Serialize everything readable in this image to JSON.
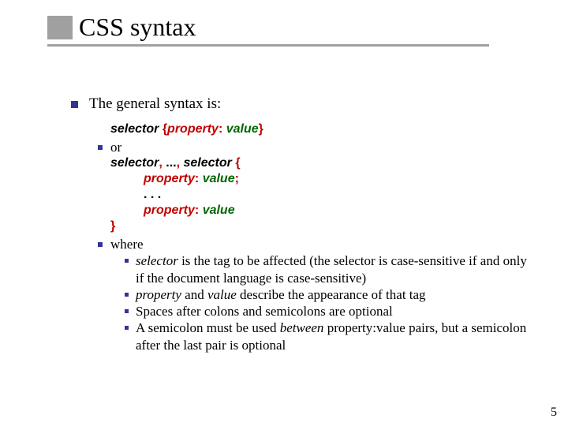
{
  "title": "CSS syntax",
  "lead": "The general syntax is:",
  "code1": {
    "sel": "selector",
    "lb": " {",
    "prop": "property",
    "colon": ": ",
    "val": "value",
    "rb": "}"
  },
  "or": "or",
  "code2": {
    "line1_a": "selector",
    "line1_b": ", ",
    "line1_c": "...",
    "line1_d": ", ",
    "line1_e": "selector",
    "line1_f": " {",
    "line2_prop": "property",
    "line2_colon": ": ",
    "line2_val": "value",
    "line2_semi": ";",
    "line3": ". . .",
    "line4_prop": "property",
    "line4_colon": ": ",
    "line4_val": "value",
    "line5": "}"
  },
  "where": "where",
  "defs": {
    "d1_a": "selector",
    "d1_b": " is the tag to be affected (the selector is case-sensitive if and only if the document language is case-sensitive)",
    "d2_a": "property",
    "d2_b": " and ",
    "d2_c": "value",
    "d2_d": " describe the appearance of that tag",
    "d3": "Spaces after colons and semicolons are optional",
    "d4_a": "A semicolon must be used ",
    "d4_b": "between",
    "d4_c": " property:value pairs, but a semicolon after the last pair is optional"
  },
  "pagenum": "5"
}
